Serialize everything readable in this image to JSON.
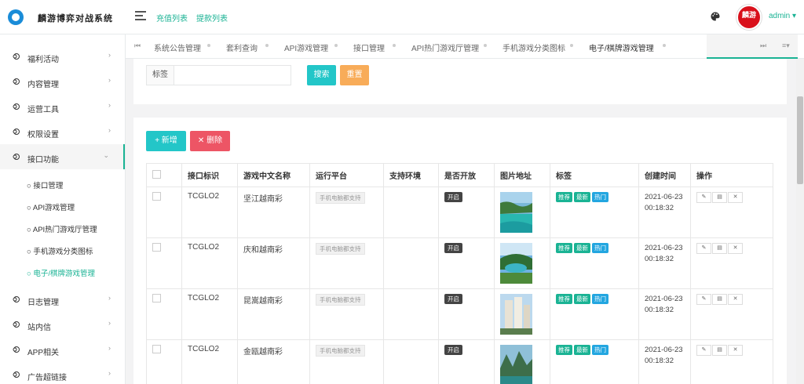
{
  "app": {
    "brand": "麟游博弈对战系统",
    "logo_icon": "swirl-logo-icon"
  },
  "header": {
    "links": [
      "充值列表",
      "提款列表"
    ],
    "user": "admin ▾",
    "avatar_text": "麟游",
    "accent_color": "#1ab394"
  },
  "sidebar": {
    "items": [
      {
        "label": "福利活动",
        "arrow": "›"
      },
      {
        "label": "内容管理",
        "arrow": "›"
      },
      {
        "label": "运营工具",
        "arrow": "›"
      },
      {
        "label": "权限设置",
        "arrow": "›"
      },
      {
        "label": "接口功能",
        "arrow": "⌄"
      },
      {
        "label": "日志管理",
        "arrow": "›"
      },
      {
        "label": "站内信",
        "arrow": "›"
      },
      {
        "label": "APP相关",
        "arrow": "›"
      },
      {
        "label": "广告超链接",
        "arrow": "›"
      }
    ],
    "subitems": [
      "接口管理",
      "API游戏管理",
      "API热门游戏厅管理",
      "手机游戏分类图标",
      "电子/棋牌游戏管理"
    ]
  },
  "tabs": {
    "nav_prev": "⏮",
    "nav_next": "⏭",
    "menu": "≡▾",
    "items": [
      "系统公告管理",
      "套利查询",
      "API游戏管理",
      "接口管理",
      "API热门游戏厅管理",
      "手机游戏分类图标",
      "电子/棋牌游戏管理"
    ]
  },
  "search": {
    "label": "标签",
    "value": "",
    "search_btn": "搜索",
    "reset_btn": "重置"
  },
  "actions": {
    "add": "+ 新增",
    "delete": "✕ 删除"
  },
  "table": {
    "headers": [
      "",
      "接口标识",
      "游戏中文名称",
      "运行平台",
      "支持环境",
      "是否开放",
      "图片地址",
      "标签",
      "创建时间",
      "操作"
    ],
    "rows": [
      {
        "id": "TCGLO2",
        "name": "坚江越南彩",
        "platform": "手机电脑都支持",
        "env": "",
        "open": "开启",
        "tags": [
          "推荐",
          "最新",
          "热门"
        ],
        "date": "2021-06-23",
        "time": "00:18:32"
      },
      {
        "id": "TCGLO2",
        "name": "庆和越南彩",
        "platform": "手机电脑都支持",
        "env": "",
        "open": "开启",
        "tags": [
          "推荐",
          "最新",
          "热门"
        ],
        "date": "2021-06-23",
        "time": "00:18:32"
      },
      {
        "id": "TCGLO2",
        "name": "昆嵩越南彩",
        "platform": "手机电脑都支持",
        "env": "",
        "open": "开启",
        "tags": [
          "推荐",
          "最新",
          "热门"
        ],
        "date": "2021-06-23",
        "time": "00:18:32"
      },
      {
        "id": "TCGLO2",
        "name": "金瓯越南彩",
        "platform": "手机电脑都支持",
        "env": "",
        "open": "开启",
        "tags": [
          "推荐",
          "最新",
          "热门"
        ],
        "date": "2021-06-23",
        "time": "00:18:32"
      }
    ],
    "tag_colors": [
      "#1ab394",
      "#1c84c6",
      "#23c6c8"
    ],
    "op_icons": [
      "✎",
      "▤",
      "✕"
    ]
  }
}
